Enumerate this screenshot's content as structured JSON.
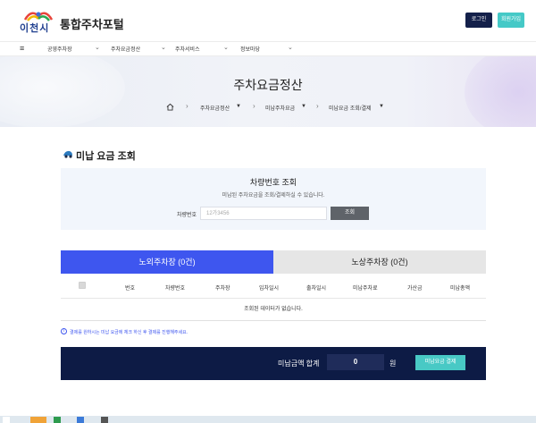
{
  "header": {
    "logo_text": "이천시",
    "site_title": "통합주차포털",
    "login_label": "로그인",
    "join_label": "회원가입"
  },
  "nav": {
    "menu_icon": "hamburger-icon",
    "items": [
      {
        "label": "공영주차장"
      },
      {
        "label": "주차요금정산"
      },
      {
        "label": "주차서비스"
      },
      {
        "label": "정보마당"
      }
    ]
  },
  "banner": {
    "title": "주차요금정산",
    "breadcrumb": [
      "주차요금정산",
      "미납주차요금",
      "미납요금 조회/결제"
    ]
  },
  "section": {
    "title": "미납 요금 조회"
  },
  "search": {
    "title": "차량번호 조회",
    "description": "미납된 주차요금을 조회/결제하실 수 있습니다.",
    "plate_label": "차량번호",
    "plate_placeholder": "12가3456",
    "button_label": "조회"
  },
  "tabs": [
    {
      "label": "노외주차장 (0건)",
      "active": true
    },
    {
      "label": "노상주차장 (0건)",
      "active": false
    }
  ],
  "table": {
    "columns": [
      "번호",
      "차량번호",
      "주차장",
      "입차일시",
      "출차일시",
      "미납주차료",
      "가산금",
      "미납총액"
    ],
    "empty_message": "조회된 데이터가 없습니다."
  },
  "notice": {
    "text": "결제를 원하시는 미납 요금에 체크 하신 후 결제를 진행해주세요."
  },
  "total": {
    "label": "미납금액 합계",
    "value": "0",
    "unit": "원",
    "pay_label": "미납요금 결제"
  },
  "colors": {
    "navy": "#0d1b45",
    "accent_blue": "#3e56ef",
    "teal": "#48c9c5"
  }
}
